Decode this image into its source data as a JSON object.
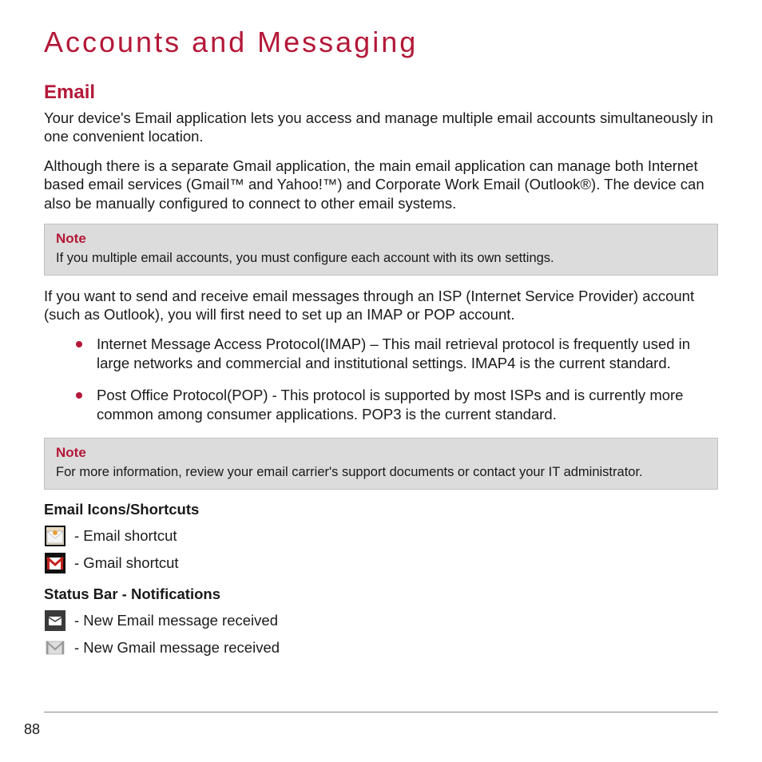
{
  "chapter_title": "Accounts and Messaging",
  "section_title": "Email",
  "intro_para1": "Your device's Email application lets you access and manage multiple email accounts simultaneously in one convenient location.",
  "intro_para2": "Although there is a separate Gmail application, the main email application can manage both Internet based email services (Gmail™ and Yahoo!™) and Corporate Work Email (Outlook®). The device can also be manually configured to connect to other email systems.",
  "note1": {
    "label": "Note",
    "text": "If you multiple email accounts, you must configure each account with its own settings."
  },
  "isp_para": "If you want to send and receive email messages through an ISP (Internet Service Provider) account (such as Outlook), you will first need to set up an IMAP or POP account.",
  "protocols": [
    "Internet Message Access Protocol(IMAP) – This mail retrieval protocol is frequently used in large networks and commercial and institutional settings. IMAP4 is the current standard.",
    "Post Office Protocol(POP) - This protocol is supported by most ISPs and is currently more common among consumer applications. POP3 is the current standard."
  ],
  "note2": {
    "label": "Note",
    "text": "For more information, review your email carrier's support documents or contact your IT administrator."
  },
  "icons_heading": "Email Icons/Shortcuts",
  "shortcuts": [
    {
      "label": "- Email shortcut"
    },
    {
      "label": "- Gmail shortcut"
    }
  ],
  "status_heading": "Status Bar - Notifications",
  "notifications": [
    {
      "label": "- New Email message received"
    },
    {
      "label": "- New Gmail message received"
    }
  ],
  "page_number": "88"
}
